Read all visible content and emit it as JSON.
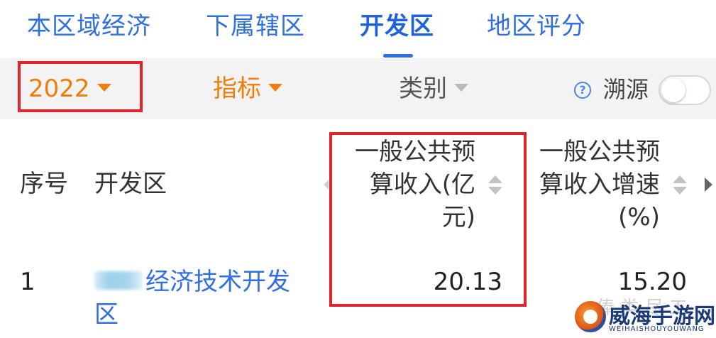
{
  "tabs": [
    {
      "label": "本区域经济",
      "active": false
    },
    {
      "label": "下属辖区",
      "active": false
    },
    {
      "label": "开发区",
      "active": true
    },
    {
      "label": "地区评分",
      "active": false
    }
  ],
  "filters": {
    "year": "2022",
    "indicator": "指标",
    "category": "类别",
    "trace_label": "溯源",
    "trace_enabled": false
  },
  "table": {
    "headers": {
      "index": "序号",
      "zone": "开发区",
      "revenue": [
        "一般公共预",
        "算收入(亿",
        "元)"
      ],
      "growth": [
        "一般公共预",
        "算收入增速",
        "(%)"
      ]
    },
    "rows": [
      {
        "index": "1",
        "zone_line1": "经济技术开发",
        "zone_line2": "区",
        "revenue": "20.13",
        "growth": "15.20"
      }
    ]
  },
  "watermarks": {
    "text": "俸 类 尽 工",
    "logo_title": "威海手游网",
    "logo_subtitle": "WEIHAISHOUYOUWANG"
  },
  "colors": {
    "accent_blue": "#2f6fe0",
    "accent_orange": "#f07d0b",
    "highlight_red": "#e0242c"
  }
}
